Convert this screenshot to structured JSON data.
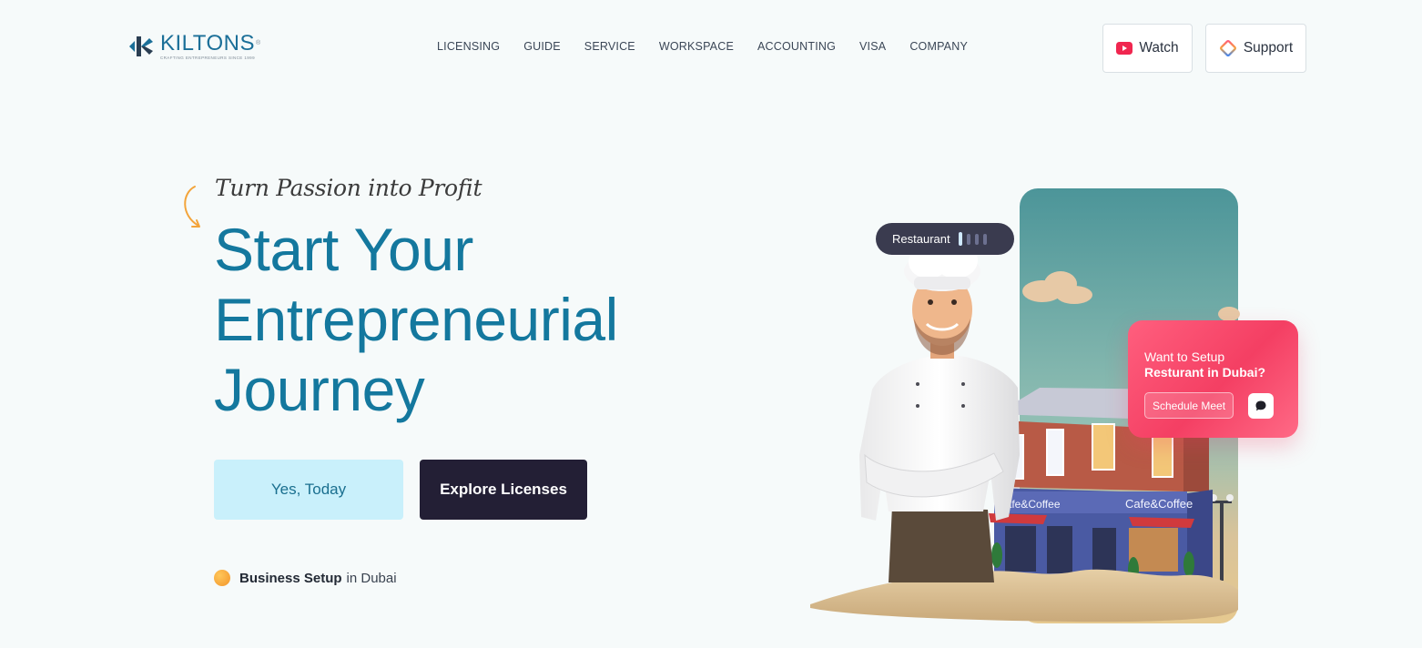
{
  "brand": {
    "name": "KILTONS",
    "registered": "®",
    "tagline": "CRAFTING ENTREPRENEURS SINCE 1999"
  },
  "nav": {
    "items": [
      {
        "label": "LICENSING"
      },
      {
        "label": "GUIDE"
      },
      {
        "label": "SERVICE"
      },
      {
        "label": "WORKSPACE"
      },
      {
        "label": "ACCOUNTING"
      },
      {
        "label": "VISA"
      },
      {
        "label": "COMPANY"
      }
    ]
  },
  "header_actions": {
    "watch_label": "Watch",
    "support_label": "Support"
  },
  "hero": {
    "tagline": "Turn Passion into Profit",
    "headline": [
      "Start Your",
      "Entrepreneurial",
      "Journey"
    ],
    "primary_cta": "Yes, Today",
    "secondary_cta": "Explore Licenses",
    "biz_bold": "Business Setup",
    "biz_rest": "in Dubai"
  },
  "illustration": {
    "category_pill": "Restaurant",
    "storefront_sign_left": "Cafe&Coffee",
    "storefront_sign_right": "Cafe&Coffee",
    "promo_line1": "Want to Setup",
    "promo_line2": "Resturant in Dubai?",
    "promo_button": "Schedule Meet"
  },
  "colors": {
    "background": "#f6fafa",
    "headline": "#14789e",
    "primary_cta_bg": "#c9f0fb",
    "secondary_cta_bg": "#231f35",
    "promo_card": "#f43f63",
    "watch_icon": "#f0264f"
  },
  "icons": [
    "kiltons-logo-icon",
    "play-icon",
    "support-diamond-icon",
    "curved-arrow-icon",
    "chat-icon"
  ]
}
